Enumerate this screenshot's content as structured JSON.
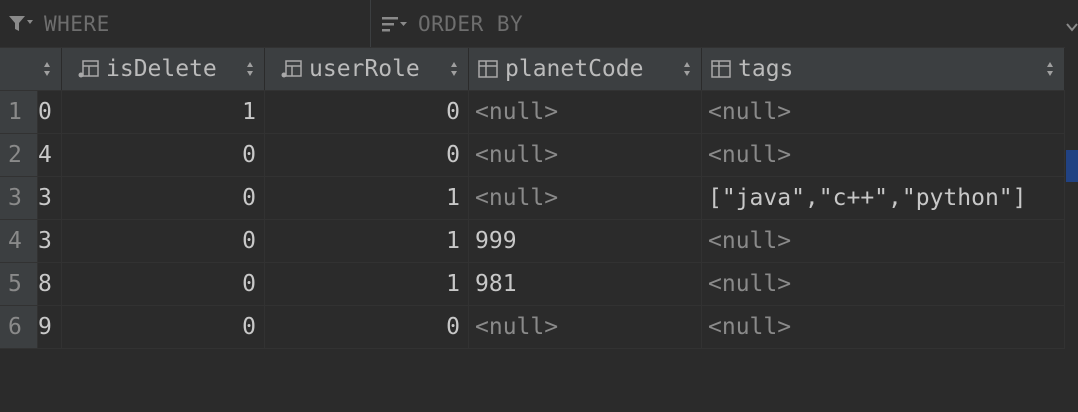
{
  "filter": {
    "where_placeholder": "WHERE",
    "order_placeholder": "ORDER BY"
  },
  "columns": [
    {
      "label": "",
      "name": "id"
    },
    {
      "label": "isDelete",
      "name": "isDelete"
    },
    {
      "label": "userRole",
      "name": "userRole"
    },
    {
      "label": "planetCode",
      "name": "planetCode"
    },
    {
      "label": "tags",
      "name": "tags"
    }
  ],
  "rows": [
    {
      "n": "1",
      "id": "0",
      "isDelete": "1",
      "userRole": "0",
      "planetCode": "<null>",
      "tags": "<null>"
    },
    {
      "n": "2",
      "id": "4",
      "isDelete": "0",
      "userRole": "0",
      "planetCode": "<null>",
      "tags": "<null>"
    },
    {
      "n": "3",
      "id": "3",
      "isDelete": "0",
      "userRole": "1",
      "planetCode": "<null>",
      "tags": "[\"java\",\"c++\",\"python\"]"
    },
    {
      "n": "4",
      "id": "3",
      "isDelete": "0",
      "userRole": "1",
      "planetCode": "999",
      "tags": "<null>"
    },
    {
      "n": "5",
      "id": "8",
      "isDelete": "0",
      "userRole": "1",
      "planetCode": "981",
      "tags": "<null>"
    },
    {
      "n": "6",
      "id": "9",
      "isDelete": "0",
      "userRole": "0",
      "planetCode": "<null>",
      "tags": "<null>"
    }
  ],
  "colors": {
    "background": "#2b2b2b",
    "header": "#3c3f41",
    "text": "#c8c8c8",
    "null_text": "#8a8a8a",
    "placeholder": "#6e6e6e"
  }
}
